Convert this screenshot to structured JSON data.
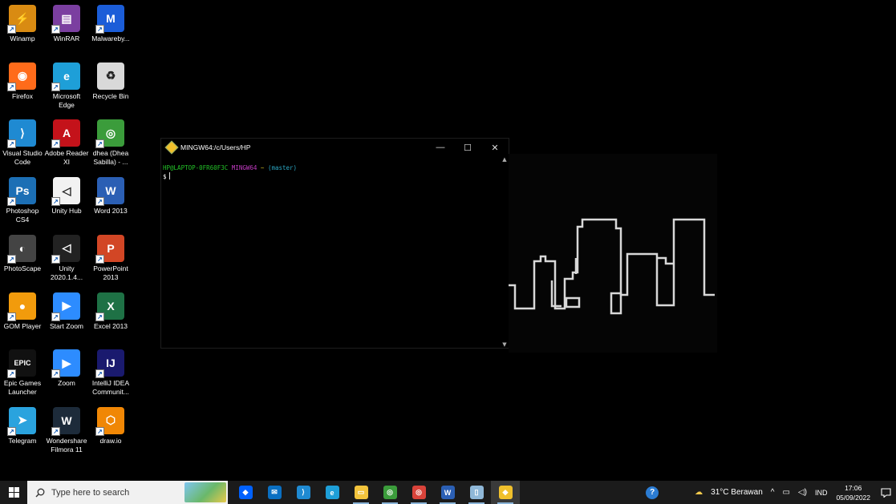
{
  "desktop_icons": [
    {
      "label": "Winamp",
      "icon": "winamp-icon",
      "color": "#d98b12"
    },
    {
      "label": "WinRAR",
      "icon": "winrar-icon",
      "color": "#7b3fa0"
    },
    {
      "label": "Malwareby...",
      "icon": "malwarebytes-icon",
      "color": "#1b5dd8"
    },
    {
      "label": "Firefox",
      "icon": "firefox-icon",
      "color": "#ff6b1a"
    },
    {
      "label": "Microsoft Edge",
      "icon": "edge-icon",
      "color": "#1e9fd8"
    },
    {
      "label": "Recycle Bin",
      "icon": "recycle-bin-icon",
      "color": "#d9d9d9"
    },
    {
      "label": "Visual Studio Code",
      "icon": "vscode-icon",
      "color": "#1f8ad2"
    },
    {
      "label": "Adobe Reader XI",
      "icon": "adobe-reader-icon",
      "color": "#c4121a"
    },
    {
      "label": "dhea (Dhea Sabilla) - ...",
      "icon": "chrome-icon",
      "color": "#3b9c3b"
    },
    {
      "label": "Photoshop CS4",
      "icon": "photoshop-icon",
      "color": "#1c6fb5"
    },
    {
      "label": "Unity Hub",
      "icon": "unity-hub-icon",
      "color": "#f2f2f2"
    },
    {
      "label": "Word 2013",
      "icon": "word-icon",
      "color": "#2b5fb4"
    },
    {
      "label": "PhotoScape",
      "icon": "photoscape-icon",
      "color": "#444444"
    },
    {
      "label": "Unity 2020.1.4...",
      "icon": "unity-icon",
      "color": "#222222"
    },
    {
      "label": "PowerPoint 2013",
      "icon": "powerpoint-icon",
      "color": "#d24625"
    },
    {
      "label": "GOM Player",
      "icon": "gom-player-icon",
      "color": "#f29b0c"
    },
    {
      "label": "Start Zoom",
      "icon": "zoom-icon",
      "color": "#2d8cff"
    },
    {
      "label": "Excel 2013",
      "icon": "excel-icon",
      "color": "#1e7145"
    },
    {
      "label": "Epic Games Launcher",
      "icon": "epic-games-icon",
      "color": "#111111"
    },
    {
      "label": "Zoom",
      "icon": "zoom-icon",
      "color": "#2d8cff"
    },
    {
      "label": "IntelliJ IDEA Communit...",
      "icon": "intellij-icon",
      "color": "#1a1a6e"
    },
    {
      "label": "Telegram",
      "icon": "telegram-icon",
      "color": "#2aa3de"
    },
    {
      "label": "Wondershare Filmora 11",
      "icon": "filmora-icon",
      "color": "#1d2b3a"
    },
    {
      "label": "draw.io",
      "icon": "drawio-icon",
      "color": "#f08705"
    }
  ],
  "desktop_icon_glyphs": [
    "⚡",
    "▤",
    "M",
    "◉",
    "e",
    "♻",
    "⟩",
    "A",
    "◎",
    "Ps",
    "◁",
    "W",
    "◐",
    "◁",
    "P",
    "●",
    "▶",
    "X",
    "EPIC",
    "▶",
    "IJ",
    "➤",
    "W",
    "⬡"
  ],
  "terminal": {
    "title": "MINGW64:/c/Users/HP",
    "prompt_user": "HP@LAPTOP-0FR60F3C",
    "prompt_host": "MINGW64",
    "prompt_path": "~",
    "prompt_branch": "(master)",
    "prompt_symbol": "$"
  },
  "taskbar": {
    "search_placeholder": "Type here to search",
    "apps": [
      {
        "icon": "dropbox-icon",
        "color": "#0061fe",
        "glyph": "◆"
      },
      {
        "icon": "mail-icon",
        "color": "#0a6fc2",
        "glyph": "✉"
      },
      {
        "icon": "vscode-icon",
        "color": "#1f8ad2",
        "glyph": "⟩"
      },
      {
        "icon": "edge-icon",
        "color": "#1e9fd8",
        "glyph": "e"
      },
      {
        "icon": "file-explorer-icon",
        "color": "#f3c43c",
        "glyph": "▭"
      },
      {
        "icon": "chrome-icon",
        "color": "#3b9c3b",
        "glyph": "◎"
      },
      {
        "icon": "chrome-profile-icon",
        "color": "#d9433a",
        "glyph": "◎"
      },
      {
        "icon": "word-icon",
        "color": "#2b5fb4",
        "glyph": "W"
      },
      {
        "icon": "notepad-icon",
        "color": "#8fb8d8",
        "glyph": "▯"
      },
      {
        "icon": "git-bash-icon",
        "color": "#f0c02c",
        "glyph": "◆"
      }
    ],
    "weather": "31°C  Berawan",
    "language": "IND",
    "time": "17:06",
    "date": "05/09/2022"
  }
}
